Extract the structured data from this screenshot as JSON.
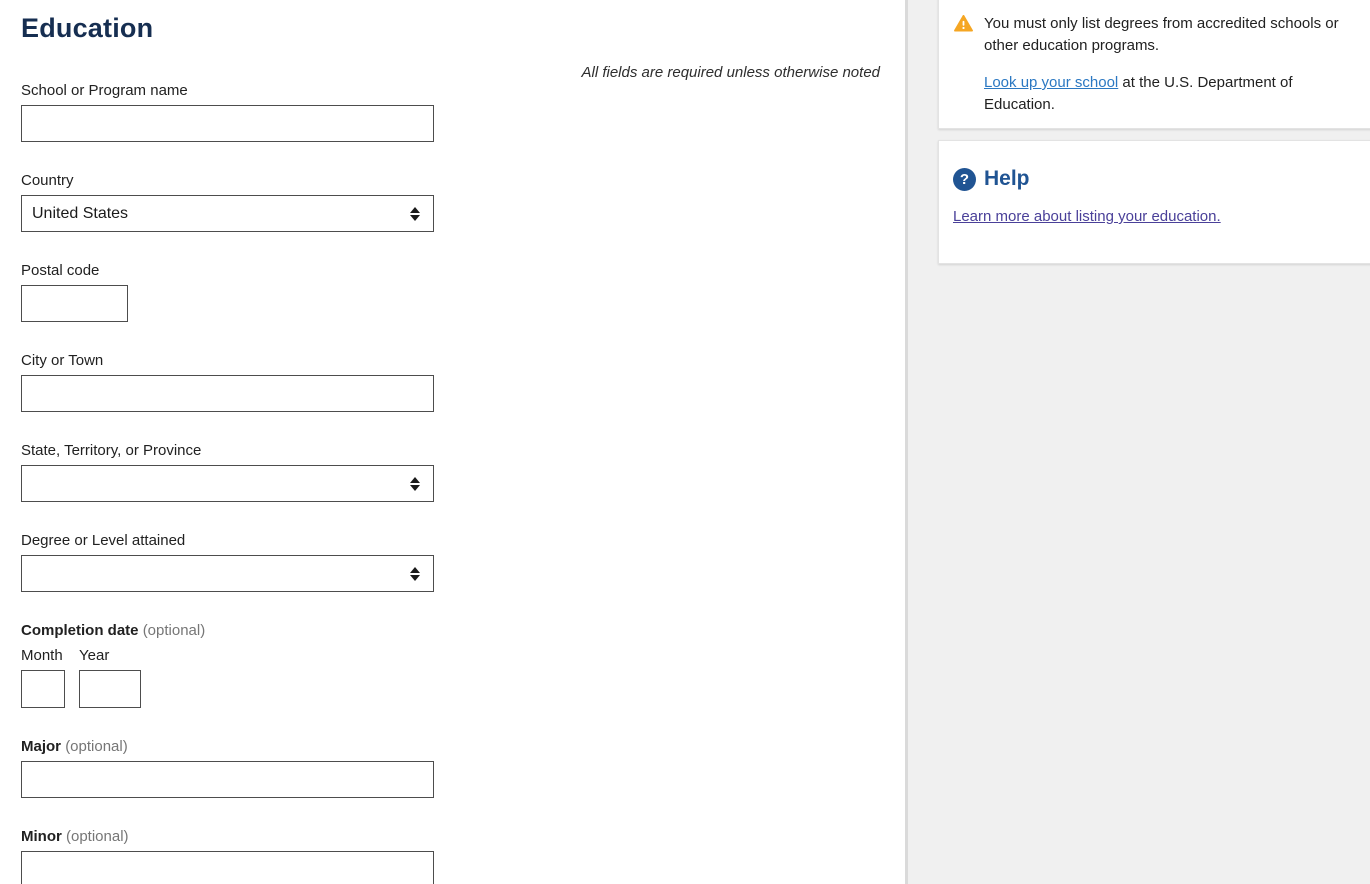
{
  "page": {
    "title": "Education",
    "required_note": "All fields are required unless otherwise noted"
  },
  "form": {
    "school": {
      "label": "School or Program name",
      "value": ""
    },
    "country": {
      "label": "Country",
      "value": "United States"
    },
    "postal": {
      "label": "Postal code",
      "value": ""
    },
    "city": {
      "label": "City or Town",
      "value": ""
    },
    "state": {
      "label": "State, Territory, or Province",
      "value": ""
    },
    "degree": {
      "label": "Degree or Level attained",
      "value": ""
    },
    "completion": {
      "label": "Completion date",
      "optional": "(optional)",
      "month": {
        "label": "Month",
        "value": ""
      },
      "year": {
        "label": "Year",
        "value": ""
      }
    },
    "major": {
      "label": "Major",
      "optional": "(optional)",
      "value": ""
    },
    "minor": {
      "label": "Minor",
      "optional": "(optional)",
      "value": ""
    }
  },
  "sidebar": {
    "warning": {
      "icon": "warning-triangle-icon",
      "text": "You must only list degrees from accredited schools or other education programs.",
      "link_text": "Look up your school",
      "text_after_link": " at the U.S. Department of Education."
    },
    "help": {
      "icon": "question-circle-icon",
      "icon_glyph": "?",
      "title": "Help",
      "link_text": "Learn more about listing your education."
    }
  },
  "colors": {
    "heading_navy": "#162e51",
    "help_blue": "#205493",
    "link_blue": "#2b78c2",
    "link_visited_purple": "#4a4099",
    "warning_gold": "#f5a623",
    "sidebar_bg": "#f0f0f0",
    "input_border": "#4d4d4d"
  }
}
